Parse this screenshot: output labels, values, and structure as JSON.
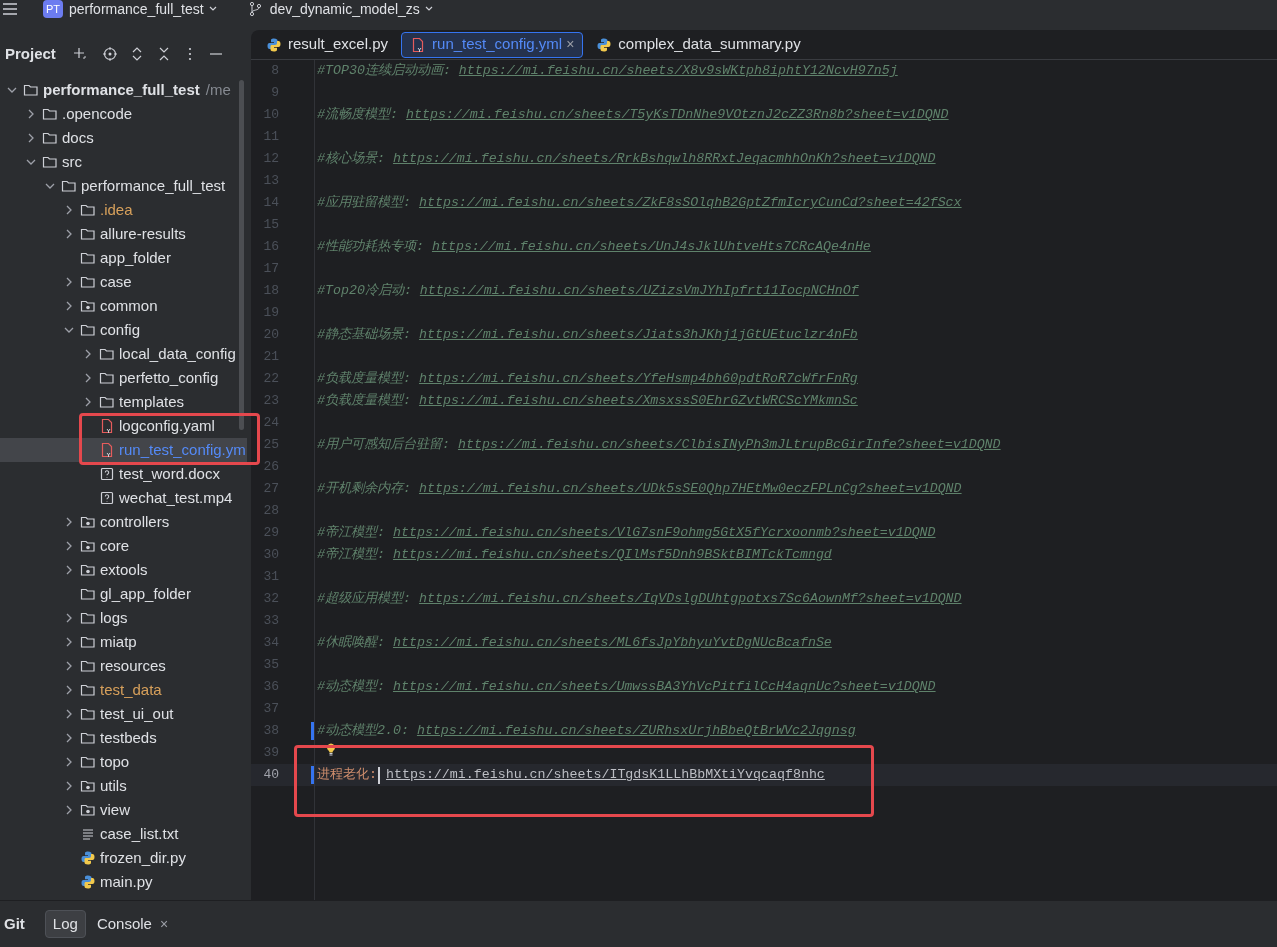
{
  "title_bar": {
    "project_badge": "PT",
    "project": "performance_full_test",
    "branch": "dev_dynamic_model_zs"
  },
  "project_panel": {
    "title": "Project",
    "tree": [
      {
        "label": "performance_full_test",
        "suffix": "/me",
        "kind": "root",
        "expanded": true,
        "ignored": false,
        "selected": false,
        "children": [
          {
            "label": ".opencode",
            "kind": "folder",
            "expanded": false,
            "ignored": false,
            "selected": false
          },
          {
            "label": "docs",
            "kind": "folder",
            "expanded": false,
            "ignored": false,
            "selected": false
          },
          {
            "label": "src",
            "kind": "folder",
            "expanded": true,
            "ignored": false,
            "selected": false,
            "children": [
              {
                "label": "performance_full_test",
                "kind": "folder",
                "expanded": true,
                "ignored": false,
                "selected": false,
                "children": [
                  {
                    "label": ".idea",
                    "kind": "folder",
                    "expanded": false,
                    "ignored": true,
                    "selected": false
                  },
                  {
                    "label": "allure-results",
                    "kind": "folder",
                    "expanded": false,
                    "ignored": false,
                    "selected": false
                  },
                  {
                    "label": "app_folder",
                    "kind": "leaf_folder",
                    "ignored": false,
                    "selected": false
                  },
                  {
                    "label": "case",
                    "kind": "folder",
                    "expanded": false,
                    "ignored": false,
                    "selected": false
                  },
                  {
                    "label": "common",
                    "kind": "package",
                    "expanded": false,
                    "ignored": false,
                    "selected": false
                  },
                  {
                    "label": "config",
                    "kind": "folder",
                    "expanded": true,
                    "ignored": false,
                    "selected": false,
                    "children": [
                      {
                        "label": "local_data_config",
                        "kind": "folder",
                        "expanded": false,
                        "ignored": false,
                        "selected": false
                      },
                      {
                        "label": "perfetto_config",
                        "kind": "folder",
                        "expanded": false,
                        "ignored": false,
                        "selected": false
                      },
                      {
                        "label": "templates",
                        "kind": "folder",
                        "expanded": false,
                        "ignored": false,
                        "selected": false
                      },
                      {
                        "label": "logconfig.yaml",
                        "kind": "yaml",
                        "ignored": false,
                        "selected": false
                      },
                      {
                        "label": "run_test_config.ym",
                        "kind": "yaml",
                        "ignored": false,
                        "selected": true
                      },
                      {
                        "label": "test_word.docx",
                        "kind": "unknown",
                        "ignored": false,
                        "selected": false
                      },
                      {
                        "label": "wechat_test.mp4",
                        "kind": "unknown",
                        "ignored": false,
                        "selected": false
                      }
                    ]
                  },
                  {
                    "label": "controllers",
                    "kind": "package",
                    "expanded": false,
                    "ignored": false,
                    "selected": false
                  },
                  {
                    "label": "core",
                    "kind": "package",
                    "expanded": false,
                    "ignored": false,
                    "selected": false
                  },
                  {
                    "label": "extools",
                    "kind": "package",
                    "expanded": false,
                    "ignored": false,
                    "selected": false
                  },
                  {
                    "label": "gl_app_folder",
                    "kind": "leaf_folder",
                    "ignored": false,
                    "selected": false
                  },
                  {
                    "label": "logs",
                    "kind": "folder",
                    "expanded": false,
                    "ignored": false,
                    "selected": false
                  },
                  {
                    "label": "miatp",
                    "kind": "folder",
                    "expanded": false,
                    "ignored": false,
                    "selected": false
                  },
                  {
                    "label": "resources",
                    "kind": "folder",
                    "expanded": false,
                    "ignored": false,
                    "selected": false
                  },
                  {
                    "label": "test_data",
                    "kind": "folder",
                    "expanded": false,
                    "ignored": true,
                    "selected": false
                  },
                  {
                    "label": "test_ui_out",
                    "kind": "folder",
                    "expanded": false,
                    "ignored": false,
                    "selected": false
                  },
                  {
                    "label": "testbeds",
                    "kind": "folder",
                    "expanded": false,
                    "ignored": false,
                    "selected": false
                  },
                  {
                    "label": "topo",
                    "kind": "folder",
                    "expanded": false,
                    "ignored": false,
                    "selected": false
                  },
                  {
                    "label": "utils",
                    "kind": "package",
                    "expanded": false,
                    "ignored": false,
                    "selected": false
                  },
                  {
                    "label": "view",
                    "kind": "package",
                    "expanded": false,
                    "ignored": false,
                    "selected": false
                  },
                  {
                    "label": "case_list.txt",
                    "kind": "text",
                    "ignored": false,
                    "selected": false
                  },
                  {
                    "label": "frozen_dir.py",
                    "kind": "python",
                    "ignored": false,
                    "selected": false
                  },
                  {
                    "label": "main.py",
                    "kind": "python",
                    "ignored": false,
                    "selected": false
                  }
                ]
              }
            ]
          }
        ]
      }
    ]
  },
  "editor_tabs": [
    {
      "label": "result_excel.py",
      "kind": "python",
      "selected": false
    },
    {
      "label": "run_test_config.yml",
      "kind": "yaml",
      "selected": true,
      "close": "×"
    },
    {
      "label": "complex_data_summary.py",
      "kind": "python",
      "selected": false
    }
  ],
  "editor_lines": [
    {
      "number": "8",
      "kind": "comment",
      "comment": "#TOP30连续启动动画:",
      "url": "https://mi.feishu.cn/sheets/X8v9sWKtph8iphtY12NcvH97n5j"
    },
    {
      "number": "9",
      "kind": "blank"
    },
    {
      "number": "10",
      "kind": "comment",
      "comment": "#流畅度模型:",
      "url": "https://mi.feishu.cn/sheets/T5yKsTDnNhe9VOtznJ2cZZ3Rn8b?sheet=v1DQND"
    },
    {
      "number": "11",
      "kind": "blank"
    },
    {
      "number": "12",
      "kind": "comment",
      "comment": "#核心场景:",
      "url": "https://mi.feishu.cn/sheets/RrkBshqwlh8RRxtJeqacmhhOnKh?sheet=v1DQND"
    },
    {
      "number": "13",
      "kind": "blank"
    },
    {
      "number": "14",
      "kind": "comment",
      "comment": "#应用驻留模型:",
      "url": "https://mi.feishu.cn/sheets/ZkF8sSOlqhB2GptZfmIcryCunCd?sheet=42fScx"
    },
    {
      "number": "15",
      "kind": "blank"
    },
    {
      "number": "16",
      "kind": "comment",
      "comment": "#性能功耗热专项:",
      "url": "https://mi.feishu.cn/sheets/UnJ4sJklUhtveHts7CRcAQe4nHe"
    },
    {
      "number": "17",
      "kind": "blank"
    },
    {
      "number": "18",
      "kind": "comment",
      "comment": "#Top20冷启动:",
      "url": "https://mi.feishu.cn/sheets/UZizsVmJYhIpfrt11IocpNCHnOf"
    },
    {
      "number": "19",
      "kind": "blank"
    },
    {
      "number": "20",
      "kind": "comment",
      "comment": "#静态基础场景:",
      "url": "https://mi.feishu.cn/sheets/Jiats3hJKhj1jGtUEtuclzr4nFb"
    },
    {
      "number": "21",
      "kind": "blank"
    },
    {
      "number": "22",
      "kind": "comment",
      "comment": "#负载度量模型:",
      "url": "https://mi.feishu.cn/sheets/YfeHsmp4bh60pdtRoR7cWfrFnRg"
    },
    {
      "number": "23",
      "kind": "comment",
      "comment": "#负载度量模型:",
      "url": "https://mi.feishu.cn/sheets/XmsxssS0EhrGZvtWRCScYMkmnSc"
    },
    {
      "number": "24",
      "kind": "blank"
    },
    {
      "number": "25",
      "kind": "comment",
      "comment": "#用户可感知后台驻留:",
      "url": "https://mi.feishu.cn/sheets/ClbisINyPh3mJLtrupBcGirInfe?sheet=v1DQND"
    },
    {
      "number": "26",
      "kind": "blank"
    },
    {
      "number": "27",
      "kind": "comment",
      "comment": "#开机剩余内存:",
      "url": "https://mi.feishu.cn/sheets/UDk5sSE0Qhp7HEtMw0eczFPLnCg?sheet=v1DQND"
    },
    {
      "number": "28",
      "kind": "blank"
    },
    {
      "number": "29",
      "kind": "comment",
      "comment": "#帝江模型:",
      "url": "https://mi.feishu.cn/sheets/VlG7snF9ohmg5GtX5fYcrxoonmb?sheet=v1DQND"
    },
    {
      "number": "30",
      "kind": "comment",
      "comment": "#帝江模型:",
      "url": "https://mi.feishu.cn/sheets/QIlMsf5Dnh9BSktBIMTckTcmngd"
    },
    {
      "number": "31",
      "kind": "blank"
    },
    {
      "number": "32",
      "kind": "comment",
      "comment": "#超级应用模型:",
      "url": "https://mi.feishu.cn/sheets/IqVDslgDUhtgpotxs7Sc6AownMf?sheet=v1DQND"
    },
    {
      "number": "33",
      "kind": "blank"
    },
    {
      "number": "34",
      "kind": "comment",
      "comment": "#休眠唤醒:",
      "url": "https://mi.feishu.cn/sheets/ML6fsJpYbhyuYvtDgNUcBcafnSe"
    },
    {
      "number": "35",
      "kind": "blank"
    },
    {
      "number": "36",
      "kind": "comment",
      "comment": "#动态模型:",
      "url": "https://mi.feishu.cn/sheets/UmwssBA3YhVcPitfilCcH4aqnUc?sheet=v1DQND"
    },
    {
      "number": "37",
      "kind": "blank"
    },
    {
      "number": "38",
      "kind": "comment",
      "comment": "#动态模型2.0:",
      "url": "https://mi.feishu.cn/sheets/ZURhsxUrjhBbeQtBrWVc2Jqgnsg",
      "changed": true
    },
    {
      "number": "39",
      "kind": "bulb"
    },
    {
      "number": "40",
      "kind": "key",
      "key": "进程老化:",
      "url": "https://mi.feishu.cn/sheets/ITgdsK1LLhBbMXtiYvqcaqf8nhc",
      "changed": true,
      "current": true
    }
  ],
  "highlight_frames": {
    "project_tree": true,
    "editor": true
  },
  "bottom_bar": {
    "title": "Git",
    "tabs": [
      {
        "label": "Log",
        "selected": true
      },
      {
        "label": "Console",
        "selected": false,
        "close": "×"
      }
    ]
  }
}
